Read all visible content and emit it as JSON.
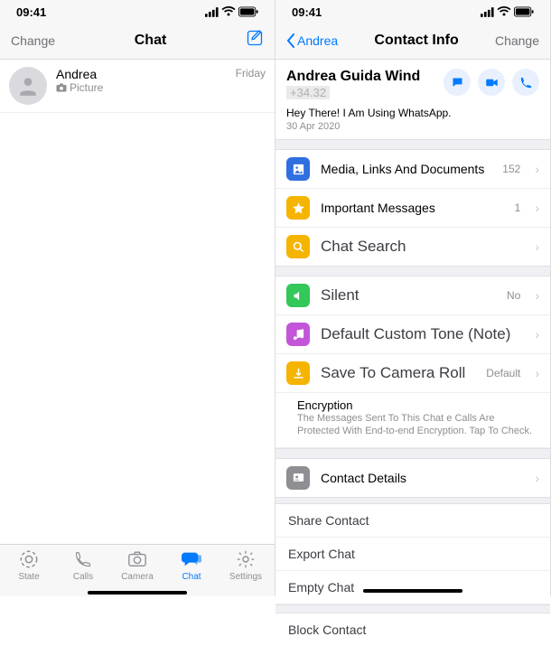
{
  "left": {
    "status_time": "09:41",
    "nav": {
      "left": "Change",
      "title": "Chat",
      "right": ""
    },
    "chat": {
      "name": "Andrea",
      "preview_icon": "camera-icon",
      "preview_text": "Picture",
      "time": "Friday"
    },
    "tabs": [
      {
        "label": "State",
        "icon": "state-icon",
        "active": false
      },
      {
        "label": "Calls",
        "icon": "phone-icon",
        "active": false
      },
      {
        "label": "Camera",
        "icon": "camera-icon",
        "active": false
      },
      {
        "label": "Chat",
        "icon": "chat-icon",
        "active": true
      },
      {
        "label": "Settings",
        "icon": "gear-icon",
        "active": false
      }
    ]
  },
  "right": {
    "status_time": "09:41",
    "nav": {
      "back": "Andrea",
      "title": "Contact Info",
      "right": "Change"
    },
    "contact": {
      "name": "Andrea Guida Wind",
      "phone": "+34.32",
      "status": "Hey There! I Am Using WhatsApp.",
      "status_date": "30 Apr 2020"
    },
    "rows": {
      "media": {
        "label": "Media, Links And Documents",
        "value": "152",
        "color": "#2f6fe0"
      },
      "important": {
        "label": "Important Messages",
        "value": "1",
        "color": "#f5b400"
      },
      "search": {
        "label": "Chat Search",
        "color": "#f5b400"
      },
      "silent": {
        "label": "Silent",
        "value": "No",
        "color": "#34c759"
      },
      "tone": {
        "label": "Default Custom Tone (Note)",
        "color": "#c355d8"
      },
      "save": {
        "label": "Save To Camera Roll",
        "value": "Default",
        "color": "#f5b400"
      },
      "encryption": {
        "title": "Encryption",
        "text": "The Messages Sent To This Chat e Calls Are Protected With End-to-end Encryption. Tap To Check.",
        "color": "#2f6fe0"
      },
      "details": {
        "label": "Contact Details"
      }
    },
    "plain": {
      "share": "Share Contact",
      "export": "Export Chat",
      "empty": "Empty Chat",
      "block": "Block Contact"
    }
  }
}
